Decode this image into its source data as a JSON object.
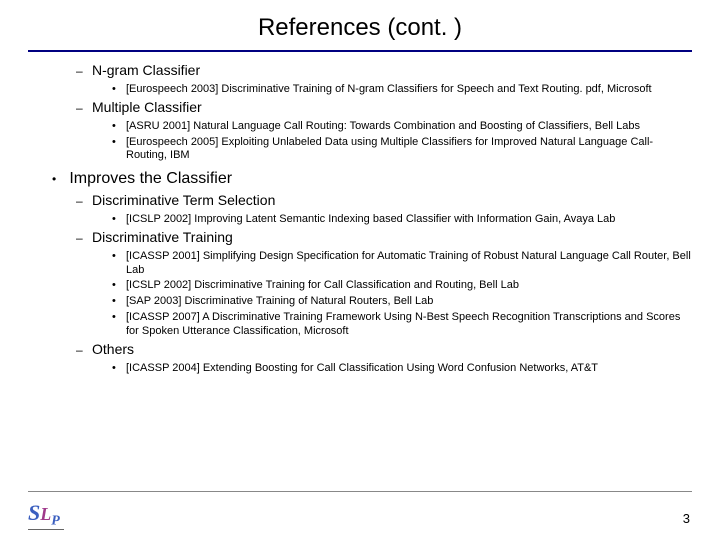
{
  "title": "References (cont. )",
  "sections_top": [
    {
      "heading": "N-gram Classifier",
      "items": [
        "[Eurospeech 2003] Discriminative Training of N-gram Classifiers for Speech and Text Routing. pdf, Microsoft"
      ]
    },
    {
      "heading": "Multiple Classifier",
      "items": [
        "[ASRU 2001] Natural Language Call Routing: Towards Combination and Boosting of Classifiers, Bell Labs",
        "[Eurospeech 2005] Exploiting Unlabeled Data using Multiple Classifiers for Improved Natural Language Call-Routing, IBM"
      ]
    }
  ],
  "main_heading": "Improves the Classifier",
  "sections_main": [
    {
      "heading": "Discriminative Term Selection",
      "items": [
        "[ICSLP 2002] Improving Latent Semantic Indexing based Classifier with Information Gain, Avaya Lab"
      ]
    },
    {
      "heading": "Discriminative Training",
      "items": [
        "[ICASSP 2001] Simplifying Design Specification for Automatic Training of Robust Natural Language Call Router, Bell Lab",
        "[ICSLP 2002] Discriminative Training for Call Classification and Routing, Bell Lab",
        "[SAP 2003] Discriminative Training of Natural Routers, Bell Lab",
        "[ICASSP 2007] A Discriminative Training Framework Using N-Best Speech Recognition Transcriptions and Scores for Spoken Utterance Classification, Microsoft"
      ]
    },
    {
      "heading": "Others",
      "items": [
        "[ICASSP 2004] Extending Boosting for Call Classification Using Word Confusion Networks, AT&T"
      ]
    }
  ],
  "page_number": "3",
  "logo": {
    "s": "S",
    "l": "L",
    "p": "P"
  }
}
